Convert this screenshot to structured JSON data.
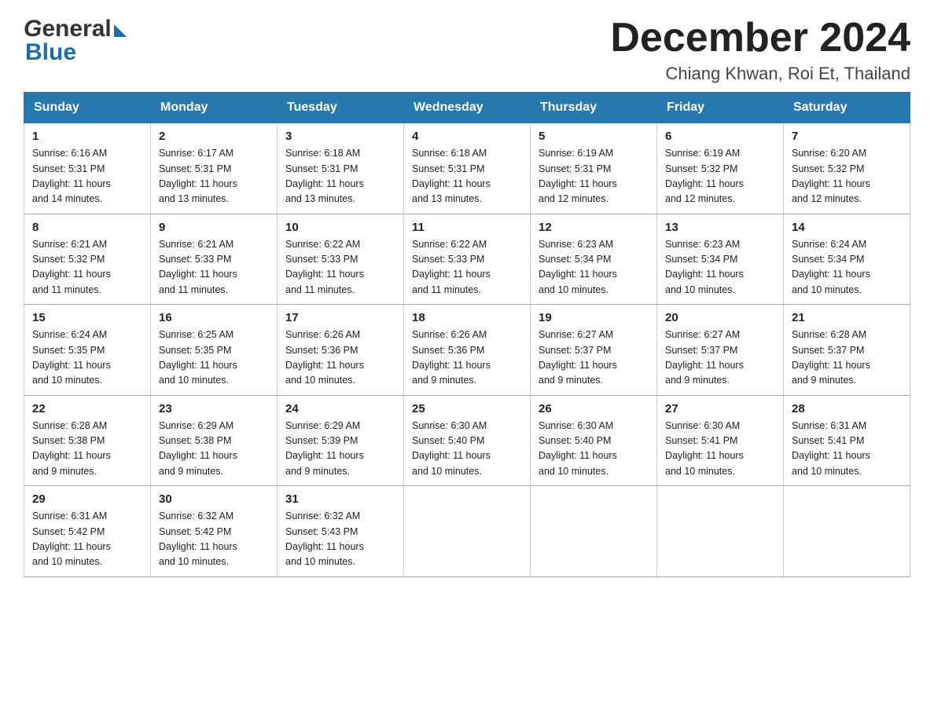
{
  "header": {
    "logo_general": "General",
    "logo_blue": "Blue",
    "month_title": "December 2024",
    "subtitle": "Chiang Khwan, Roi Et, Thailand"
  },
  "calendar": {
    "days_of_week": [
      "Sunday",
      "Monday",
      "Tuesday",
      "Wednesday",
      "Thursday",
      "Friday",
      "Saturday"
    ],
    "weeks": [
      [
        {
          "day": "1",
          "sunrise": "6:16 AM",
          "sunset": "5:31 PM",
          "daylight": "11 hours and 14 minutes."
        },
        {
          "day": "2",
          "sunrise": "6:17 AM",
          "sunset": "5:31 PM",
          "daylight": "11 hours and 13 minutes."
        },
        {
          "day": "3",
          "sunrise": "6:18 AM",
          "sunset": "5:31 PM",
          "daylight": "11 hours and 13 minutes."
        },
        {
          "day": "4",
          "sunrise": "6:18 AM",
          "sunset": "5:31 PM",
          "daylight": "11 hours and 13 minutes."
        },
        {
          "day": "5",
          "sunrise": "6:19 AM",
          "sunset": "5:31 PM",
          "daylight": "11 hours and 12 minutes."
        },
        {
          "day": "6",
          "sunrise": "6:19 AM",
          "sunset": "5:32 PM",
          "daylight": "11 hours and 12 minutes."
        },
        {
          "day": "7",
          "sunrise": "6:20 AM",
          "sunset": "5:32 PM",
          "daylight": "11 hours and 12 minutes."
        }
      ],
      [
        {
          "day": "8",
          "sunrise": "6:21 AM",
          "sunset": "5:32 PM",
          "daylight": "11 hours and 11 minutes."
        },
        {
          "day": "9",
          "sunrise": "6:21 AM",
          "sunset": "5:33 PM",
          "daylight": "11 hours and 11 minutes."
        },
        {
          "day": "10",
          "sunrise": "6:22 AM",
          "sunset": "5:33 PM",
          "daylight": "11 hours and 11 minutes."
        },
        {
          "day": "11",
          "sunrise": "6:22 AM",
          "sunset": "5:33 PM",
          "daylight": "11 hours and 11 minutes."
        },
        {
          "day": "12",
          "sunrise": "6:23 AM",
          "sunset": "5:34 PM",
          "daylight": "11 hours and 10 minutes."
        },
        {
          "day": "13",
          "sunrise": "6:23 AM",
          "sunset": "5:34 PM",
          "daylight": "11 hours and 10 minutes."
        },
        {
          "day": "14",
          "sunrise": "6:24 AM",
          "sunset": "5:34 PM",
          "daylight": "11 hours and 10 minutes."
        }
      ],
      [
        {
          "day": "15",
          "sunrise": "6:24 AM",
          "sunset": "5:35 PM",
          "daylight": "11 hours and 10 minutes."
        },
        {
          "day": "16",
          "sunrise": "6:25 AM",
          "sunset": "5:35 PM",
          "daylight": "11 hours and 10 minutes."
        },
        {
          "day": "17",
          "sunrise": "6:26 AM",
          "sunset": "5:36 PM",
          "daylight": "11 hours and 10 minutes."
        },
        {
          "day": "18",
          "sunrise": "6:26 AM",
          "sunset": "5:36 PM",
          "daylight": "11 hours and 9 minutes."
        },
        {
          "day": "19",
          "sunrise": "6:27 AM",
          "sunset": "5:37 PM",
          "daylight": "11 hours and 9 minutes."
        },
        {
          "day": "20",
          "sunrise": "6:27 AM",
          "sunset": "5:37 PM",
          "daylight": "11 hours and 9 minutes."
        },
        {
          "day": "21",
          "sunrise": "6:28 AM",
          "sunset": "5:37 PM",
          "daylight": "11 hours and 9 minutes."
        }
      ],
      [
        {
          "day": "22",
          "sunrise": "6:28 AM",
          "sunset": "5:38 PM",
          "daylight": "11 hours and 9 minutes."
        },
        {
          "day": "23",
          "sunrise": "6:29 AM",
          "sunset": "5:38 PM",
          "daylight": "11 hours and 9 minutes."
        },
        {
          "day": "24",
          "sunrise": "6:29 AM",
          "sunset": "5:39 PM",
          "daylight": "11 hours and 9 minutes."
        },
        {
          "day": "25",
          "sunrise": "6:30 AM",
          "sunset": "5:40 PM",
          "daylight": "11 hours and 10 minutes."
        },
        {
          "day": "26",
          "sunrise": "6:30 AM",
          "sunset": "5:40 PM",
          "daylight": "11 hours and 10 minutes."
        },
        {
          "day": "27",
          "sunrise": "6:30 AM",
          "sunset": "5:41 PM",
          "daylight": "11 hours and 10 minutes."
        },
        {
          "day": "28",
          "sunrise": "6:31 AM",
          "sunset": "5:41 PM",
          "daylight": "11 hours and 10 minutes."
        }
      ],
      [
        {
          "day": "29",
          "sunrise": "6:31 AM",
          "sunset": "5:42 PM",
          "daylight": "11 hours and 10 minutes."
        },
        {
          "day": "30",
          "sunrise": "6:32 AM",
          "sunset": "5:42 PM",
          "daylight": "11 hours and 10 minutes."
        },
        {
          "day": "31",
          "sunrise": "6:32 AM",
          "sunset": "5:43 PM",
          "daylight": "11 hours and 10 minutes."
        },
        null,
        null,
        null,
        null
      ]
    ],
    "labels": {
      "sunrise": "Sunrise:",
      "sunset": "Sunset:",
      "daylight": "Daylight:"
    }
  }
}
